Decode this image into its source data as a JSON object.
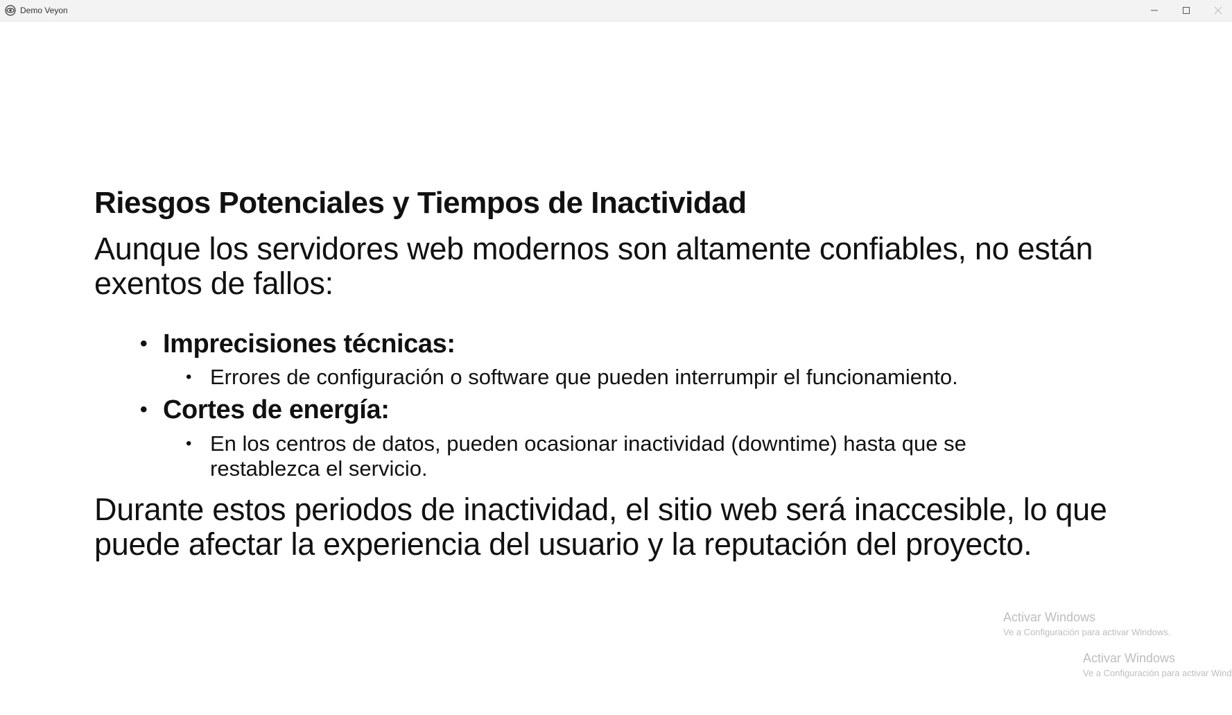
{
  "window": {
    "title": "Demo Veyon",
    "icon": "veyon-eye-icon",
    "controls": {
      "minimize_icon": "minimize-icon",
      "maximize_icon": "maximize-icon",
      "close_icon": "close-icon"
    }
  },
  "slide": {
    "title": "Riesgos Potenciales y Tiempos de Inactividad",
    "intro": "Aunque los servidores web modernos son altamente confiables, no están exentos de fallos:",
    "bullets": [
      {
        "label": "Imprecisiones técnicas:",
        "sub": "Errores de configuración o software que pueden interrumpir el funcionamiento."
      },
      {
        "label": "Cortes de energía:",
        "sub": "En los centros de datos, pueden ocasionar inactividad (downtime) hasta que se restablezca el servicio."
      }
    ],
    "closing": "Durante estos periodos de inactividad, el sitio web será inaccesible, lo que puede afectar la experiencia del usuario y la reputación del proyecto."
  },
  "watermarks": [
    {
      "title": "Activar Windows",
      "subtitle": "Ve a Configuración para activar Windows."
    },
    {
      "title": "Activar Windows",
      "subtitle": "Ve a Configuración para activar Windows."
    }
  ],
  "colors": {
    "text": "#111111",
    "titlebar_bg": "#f3f3f3",
    "watermark": "#bdbdbd"
  }
}
